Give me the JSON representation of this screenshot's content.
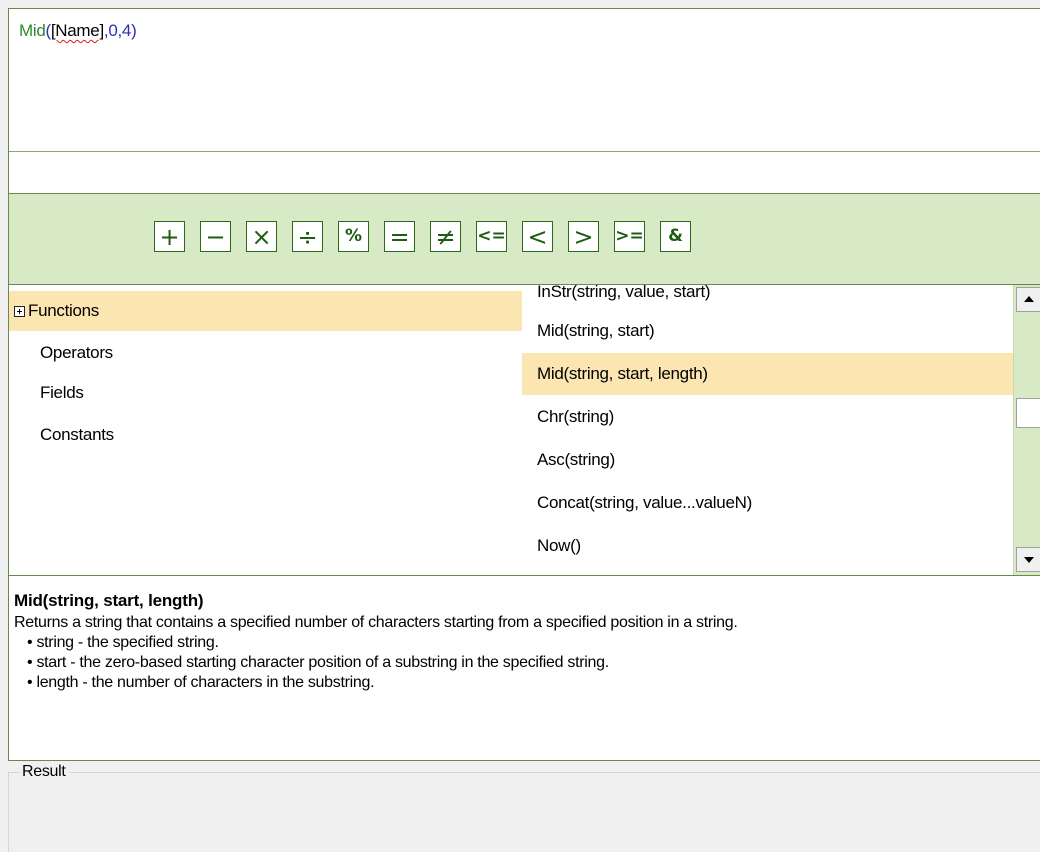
{
  "expression": {
    "func": "Mid",
    "open_paren": "(",
    "field": "[Name]",
    "comma1": ",",
    "arg1": "0",
    "comma2": ",",
    "arg2": "4",
    "close_paren": ")"
  },
  "operators": [
    {
      "symbol": "+",
      "icon": "plus-icon"
    },
    {
      "symbol": "−",
      "icon": "minus-icon"
    },
    {
      "symbol": "×",
      "icon": "multiply-icon"
    },
    {
      "symbol": "÷",
      "icon": "divide-icon"
    },
    {
      "symbol": "%",
      "icon": "percent-icon"
    },
    {
      "symbol": "=",
      "icon": "equals-icon"
    },
    {
      "symbol": "≠",
      "icon": "not-equal-icon"
    },
    {
      "symbol": "<=",
      "icon": "less-or-equal-icon"
    },
    {
      "symbol": "<",
      "icon": "less-than-icon"
    },
    {
      "symbol": ">",
      "icon": "greater-than-icon"
    },
    {
      "symbol": ">=",
      "icon": "greater-or-equal-icon"
    },
    {
      "symbol": "&",
      "icon": "ampersand-icon"
    }
  ],
  "categories": {
    "items": [
      {
        "label": "Functions",
        "expander": "expand-icon",
        "selected": true
      },
      {
        "label": "Operators"
      },
      {
        "label": "Fields"
      },
      {
        "label": "Constants"
      }
    ]
  },
  "functions": {
    "items": [
      "InStr(string, value, start)",
      "Mid(string, start)",
      "Mid(string, start, length)",
      "Chr(string)",
      "Asc(string)",
      "Concat(string, value...valueN)",
      "Now()"
    ],
    "selected_index": 2
  },
  "description": {
    "title": "Mid(string, start, length)",
    "summary": "Returns a string that contains a specified number of characters starting from a specified position in a string.",
    "params": [
      "• string - the specified string.",
      "• start - the zero-based starting character position of a substring in the specified string.",
      "• length - the number of characters in the substring."
    ]
  },
  "result": {
    "label": "Result"
  },
  "colors": {
    "accent_green": "#d8e9c6",
    "border_green": "#6a8a4a",
    "selection": "#fbe5b0",
    "operator_glyph": "#1f5c13"
  }
}
